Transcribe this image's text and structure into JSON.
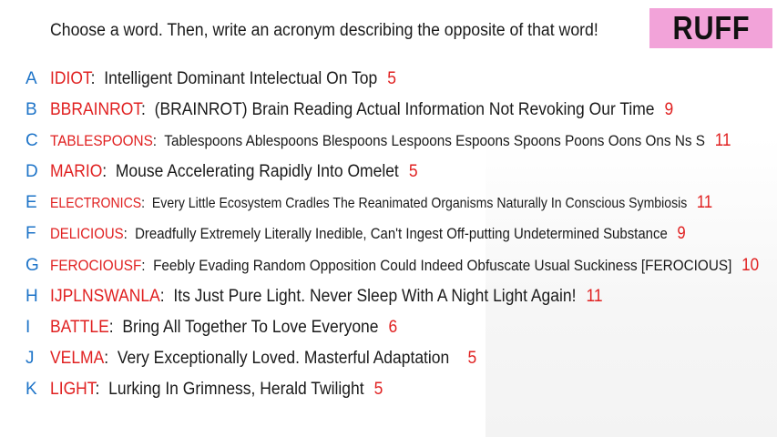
{
  "prompt": "Choose a word. Then, write an acronym describing the opposite of that word!",
  "badge": "RUFF",
  "rows": [
    {
      "letter": "A",
      "word": "IDIOT",
      "acronym": "Intelligent Dominant Intelectual On Top",
      "count": "5"
    },
    {
      "letter": "B",
      "word": "BBRAINROT",
      "acronym": "(BRAINROT) Brain Reading Actual Information Not Revoking Our Time",
      "count": "9"
    },
    {
      "letter": "C",
      "word": "TABLESPOONS",
      "acronym": "Tablespoons Ablespoons Blespoons Lespoons Espoons Spoons Poons Oons Ons Ns S",
      "count": "11"
    },
    {
      "letter": "D",
      "word": "MARIO",
      "acronym": "Mouse Accelerating Rapidly Into Omelet",
      "count": "5"
    },
    {
      "letter": "E",
      "word": "ELECTRONICS",
      "acronym": "Every Little Ecosystem Cradles The Reanimated Organisms Naturally In Conscious Symbiosis",
      "count": "11"
    },
    {
      "letter": "F",
      "word": "DELICIOUS",
      "acronym": "Dreadfully Extremely Literally Inedible, Can't Ingest Off-putting Undetermined Substance",
      "count": "9"
    },
    {
      "letter": "G",
      "word": "FEROCIOUSF",
      "acronym": "Feebly Evading Random Opposition Could Indeed Obfuscate Usual Suckiness [FEROCIOUS]",
      "count": "10"
    },
    {
      "letter": "H",
      "word": "IJPLNSWANLA",
      "acronym": "Its Just Pure Light. Never Sleep With A Night Light Again!",
      "count": "11"
    },
    {
      "letter": "I",
      "word": "BATTLE",
      "acronym": "Bring All Together To Love Everyone",
      "count": "6"
    },
    {
      "letter": "J",
      "word": "VELMA",
      "acronym": "Very Exceptionally Loved. Masterful Adaptation",
      "count": "5"
    },
    {
      "letter": "K",
      "word": "LIGHT",
      "acronym": "Lurking In Grimness, Herald Twilight",
      "count": "5"
    }
  ]
}
